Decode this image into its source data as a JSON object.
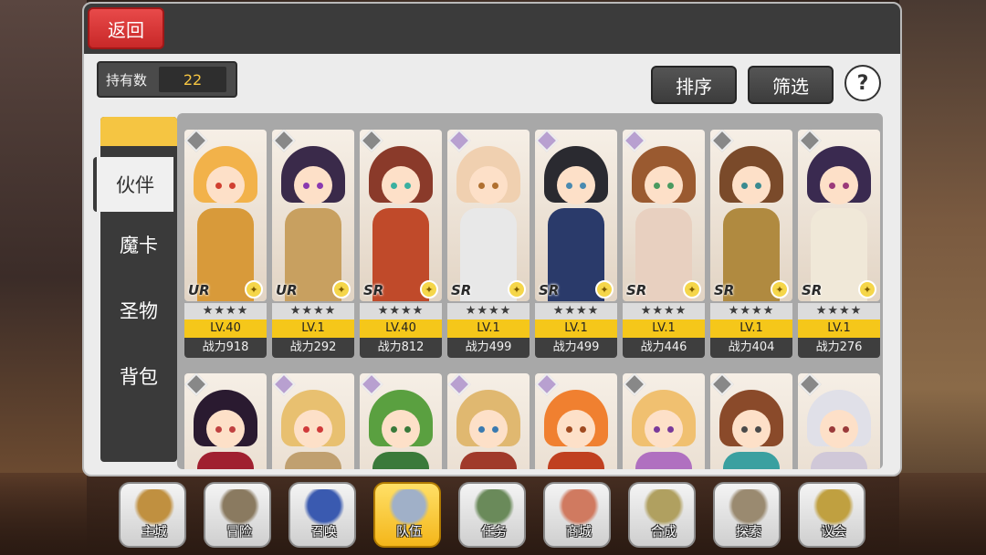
{
  "header": {
    "back_label": "返回"
  },
  "owned": {
    "label": "持有数",
    "value": "22"
  },
  "buttons": {
    "sort": "排序",
    "filter": "筛选",
    "help": "?"
  },
  "side_tabs": [
    "伙伴",
    "魔卡",
    "圣物",
    "背包"
  ],
  "active_side_tab": "伙伴",
  "cards_row1": [
    {
      "rarity": "UR",
      "stars": "★★★★",
      "level": "LV.40",
      "power": "战力918",
      "hair": "#f2b24a",
      "body": "#d89a3a",
      "eye": "#d04030",
      "el": "#888"
    },
    {
      "rarity": "UR",
      "stars": "★★★★",
      "level": "LV.1",
      "power": "战力292",
      "hair": "#3a2a4a",
      "body": "#c8a060",
      "eye": "#8a3ab0",
      "el": "#888"
    },
    {
      "rarity": "SR",
      "stars": "★★★★",
      "level": "LV.40",
      "power": "战力812",
      "hair": "#8a3a2a",
      "body": "#c04a2a",
      "eye": "#3ab0a0",
      "el": "#888"
    },
    {
      "rarity": "SR",
      "stars": "★★★★",
      "level": "LV.1",
      "power": "战力499",
      "hair": "#f0d0b0",
      "body": "#e8e8e8",
      "eye": "#b07030",
      "el": "#b8a0d0"
    },
    {
      "rarity": "SR",
      "stars": "★★★★",
      "level": "LV.1",
      "power": "战力499",
      "hair": "#2a2a30",
      "body": "#2a3a6a",
      "eye": "#4a8ab0",
      "el": "#b8a0d0"
    },
    {
      "rarity": "SR",
      "stars": "★★★★",
      "level": "LV.1",
      "power": "战力446",
      "hair": "#9a5a30",
      "body": "#e8d0c0",
      "eye": "#4a9a60",
      "el": "#b8a0d0"
    },
    {
      "rarity": "SR",
      "stars": "★★★★",
      "level": "LV.1",
      "power": "战力404",
      "hair": "#7a4a2a",
      "body": "#b08a40",
      "eye": "#3a8a90",
      "el": "#888"
    },
    {
      "rarity": "SR",
      "stars": "★★★★",
      "level": "LV.1",
      "power": "战力276",
      "hair": "#3a2a50",
      "body": "#f0e8d8",
      "eye": "#9a3a7a",
      "el": "#888"
    }
  ],
  "cards_row2": [
    {
      "hair": "#2a1a30",
      "body": "#a02030",
      "eye": "#c04040",
      "el": "#888"
    },
    {
      "hair": "#e8c070",
      "body": "#c0a070",
      "eye": "#d03a3a",
      "el": "#b8a0d0"
    },
    {
      "hair": "#5aa040",
      "body": "#3a7a3a",
      "eye": "#3a7a3a",
      "el": "#b8a0d0"
    },
    {
      "hair": "#e0b870",
      "body": "#a03a2a",
      "eye": "#3a7ab0",
      "el": "#b8a0d0"
    },
    {
      "hair": "#f08030",
      "body": "#c04020",
      "eye": "#a04a20",
      "el": "#b8a0d0"
    },
    {
      "hair": "#f0c070",
      "body": "#b070c0",
      "eye": "#7a3a9a",
      "el": "#888"
    },
    {
      "hair": "#8a4a2a",
      "body": "#3aa0a0",
      "eye": "#4a4a4a",
      "el": "#888"
    },
    {
      "hair": "#e0e0e8",
      "body": "#d0c8d8",
      "eye": "#9a3a3a",
      "el": "#888"
    }
  ],
  "nav": [
    {
      "label": "主城",
      "art": "#c09040",
      "active": false
    },
    {
      "label": "冒险",
      "art": "#8a7a60",
      "active": false
    },
    {
      "label": "召唤",
      "art": "#3a5ab0",
      "active": false
    },
    {
      "label": "队伍",
      "art": "#a0b0c8",
      "active": true
    },
    {
      "label": "任务",
      "art": "#6a8a5a",
      "active": false
    },
    {
      "label": "商城",
      "art": "#d07a60",
      "active": false
    },
    {
      "label": "合成",
      "art": "#b0a060",
      "active": false
    },
    {
      "label": "探索",
      "art": "#9a8a70",
      "active": false
    },
    {
      "label": "议会",
      "art": "#c0a040",
      "active": false
    }
  ]
}
